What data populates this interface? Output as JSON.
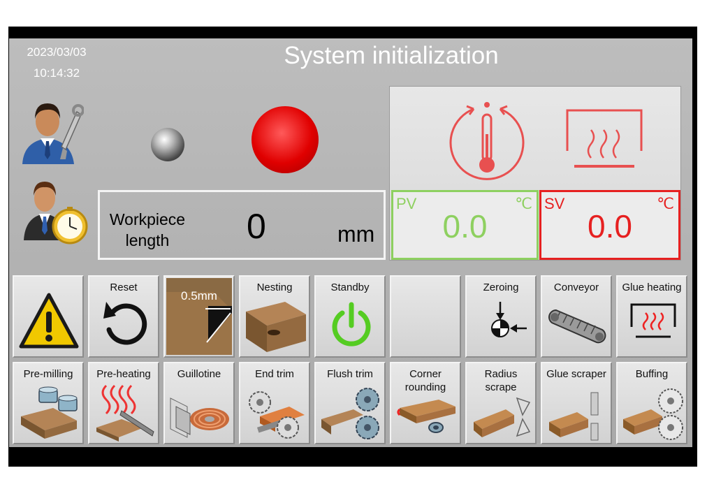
{
  "header": {
    "date": "2023/03/03",
    "time": "10:14:32",
    "title": "System initialization"
  },
  "workpiece": {
    "label_line1": "Workpiece",
    "label_line2": "length",
    "value": "0",
    "unit": "mm"
  },
  "temperature": {
    "pv_label": "PV",
    "pv_unit": "℃",
    "pv_value": "0.0",
    "sv_label": "SV",
    "sv_unit": "℃",
    "sv_value": "0.0"
  },
  "colors": {
    "pv_green": "#8ed060",
    "sv_red": "#e62020",
    "indicator_red": "#e00000",
    "icon_red": "#e85050"
  },
  "buttons_row1": [
    {
      "icon": "warning-icon",
      "label": ""
    },
    {
      "icon": "reset-icon",
      "label": "Reset"
    },
    {
      "icon": "board-thickness-icon",
      "label": "0.5mm"
    },
    {
      "icon": "nesting-icon",
      "label": "Nesting"
    },
    {
      "icon": "power-icon",
      "label": "Standby"
    },
    {
      "icon": "",
      "label": ""
    },
    {
      "icon": "zeroing-icon",
      "label": "Zeroing"
    },
    {
      "icon": "conveyor-icon",
      "label": "Conveyor"
    },
    {
      "icon": "glue-heating-icon",
      "label": "Glue heating"
    }
  ],
  "buttons_row2": [
    {
      "icon": "pre-milling-icon",
      "label": "Pre-milling"
    },
    {
      "icon": "pre-heating-icon",
      "label": "Pre-heating"
    },
    {
      "icon": "guillotine-icon",
      "label": "Guillotine"
    },
    {
      "icon": "end-trim-icon",
      "label": "End trim"
    },
    {
      "icon": "flush-trim-icon",
      "label": "Flush trim"
    },
    {
      "icon": "corner-rounding-icon",
      "label": "Corner rounding"
    },
    {
      "icon": "radius-scrape-icon",
      "label": "Radius scrape"
    },
    {
      "icon": "glue-scraper-icon",
      "label": "Glue scraper"
    },
    {
      "icon": "buffing-icon",
      "label": "Buffing"
    }
  ]
}
